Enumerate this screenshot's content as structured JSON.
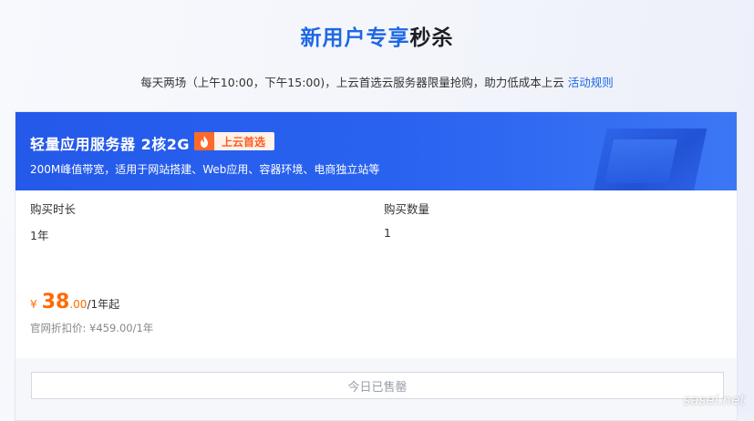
{
  "header": {
    "title_highlight": "新用户专享",
    "title_rest": "秒杀",
    "subtitle": "每天两场（上午10:00，下午15:00)，上云首选云服务器限量抢购，助力低成本上云",
    "rules_link": "活动规则"
  },
  "card": {
    "product_name": "轻量应用服务器 2核2G",
    "badge": "上云首选",
    "badge_icon": "flame-icon",
    "description": "200M峰值带宽，适用于网站搭建、Web应用、容器环境、电商独立站等",
    "duration_label": "购买时长",
    "duration_value": "1年",
    "quantity_label": "购买数量",
    "quantity_value": "1",
    "price_symbol": "¥",
    "price_int": "38",
    "price_dec": ".00",
    "price_unit": "/1年起",
    "original_price": "官网折扣价: ¥459.00/1年",
    "soldout_button": "今日已售罄"
  },
  "watermark": "sasel.net",
  "colors": {
    "accent": "#1e68e3",
    "header_bg": "#2459ea",
    "price": "#ff6a00",
    "badge": "#ff5a1f"
  }
}
